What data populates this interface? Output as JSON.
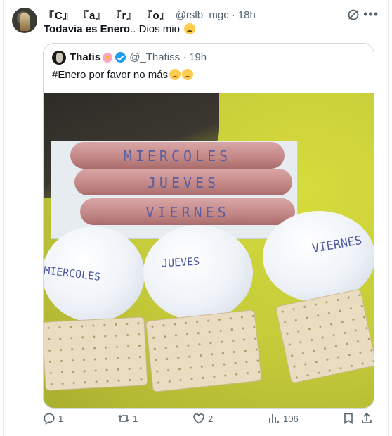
{
  "tweet": {
    "display_name": "『C』 『a』 『r』 『o』",
    "handle": "@rslb_mgc",
    "separator": "·",
    "time": "18h",
    "text_bold": "Todavia es Enero",
    "text_rest": ".. Dios mio"
  },
  "quote": {
    "display_name": "Thatis",
    "handle": "@_Thatiss",
    "separator": "·",
    "time": "19h",
    "text": "#Enero por favor no más"
  },
  "photo": {
    "sausage_labels": [
      "MIERCOLES",
      "JUEVES",
      "VIERNES"
    ],
    "egg_labels": [
      "MIERCOLES",
      "JUEVES",
      "VIERNES"
    ]
  },
  "actions": {
    "replies": "1",
    "reposts": "1",
    "likes": "2",
    "views": "106"
  },
  "colors": {
    "accent": "#1d9bf0",
    "muted_text": "#536471",
    "border": "#cfd9de"
  },
  "icons": [
    "grok-icon",
    "more-icon",
    "verified-badge-icon",
    "reply-icon",
    "repost-icon",
    "like-icon",
    "views-icon",
    "bookmark-icon",
    "share-icon"
  ]
}
